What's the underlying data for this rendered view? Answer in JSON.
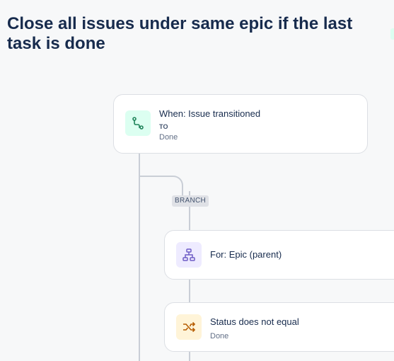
{
  "rule": {
    "title": "Close all issues under same epic if the last task is done"
  },
  "trigger": {
    "title": "When: Issue transitioned",
    "to_label": "TO",
    "to_value": "Done",
    "icon": "issue-transitioned-icon",
    "accent": "#dcfff1"
  },
  "branch": {
    "badge": "BRANCH",
    "title": "For: Epic (parent)",
    "icon": "hierarchy-icon",
    "accent": "#eeebff"
  },
  "condition": {
    "title": "Status does not equal",
    "value": "Done",
    "icon": "shuffle-icon",
    "accent": "#fff4d8"
  }
}
